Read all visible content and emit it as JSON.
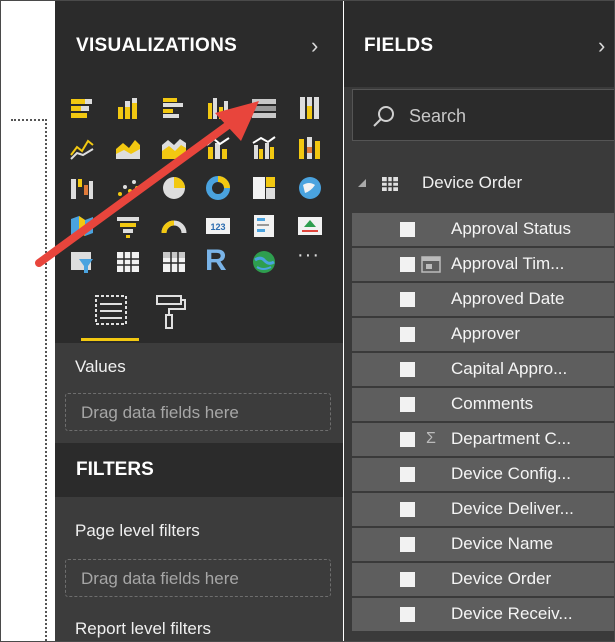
{
  "visualizations": {
    "title": "VISUALIZATIONS",
    "values_label": "Values",
    "values_drop": "Drag data fields here",
    "filters_title": "FILTERS",
    "page_level_filters": "Page level filters",
    "page_drop": "Drag data fields here",
    "report_level_filters": "Report level filters",
    "icons": [
      "stacked-bar-icon",
      "stacked-column-icon",
      "clustered-bar-icon",
      "clustered-column-icon",
      "100-stacked-bar-icon",
      "100-stacked-column-icon",
      "line-chart-icon",
      "area-chart-icon",
      "stacked-area-icon",
      "line-stacked-column-icon",
      "line-clustered-column-icon",
      "ribbon-chart-icon",
      "waterfall-icon",
      "scatter-icon",
      "pie-chart-icon",
      "donut-chart-icon",
      "treemap-icon",
      "map-icon",
      "filled-map-icon",
      "funnel-icon",
      "gauge-icon",
      "card-icon",
      "multi-row-card-icon",
      "kpi-icon",
      "slicer-icon",
      "table-icon",
      "matrix-icon",
      "r-visual-icon",
      "globe-icon",
      "more-icon"
    ],
    "r_label": "R",
    "card_label": "123",
    "more_label": "···"
  },
  "fields": {
    "title": "FIELDS",
    "search_placeholder": "Search",
    "table_name": "Device Order",
    "items": [
      {
        "label": "Approval Status",
        "type": ""
      },
      {
        "label": "Approval Tim...",
        "type": "date"
      },
      {
        "label": "Approved Date",
        "type": ""
      },
      {
        "label": "Approver",
        "type": ""
      },
      {
        "label": "Capital Appro...",
        "type": ""
      },
      {
        "label": "Comments",
        "type": ""
      },
      {
        "label": "Department C...",
        "type": "sigma"
      },
      {
        "label": "Device Config...",
        "type": ""
      },
      {
        "label": "Device Deliver...",
        "type": ""
      },
      {
        "label": "Device Name",
        "type": ""
      },
      {
        "label": "Device Order",
        "type": ""
      },
      {
        "label": "Device Receiv...",
        "type": ""
      }
    ]
  },
  "colors": {
    "accent": "#f2c811",
    "arrow": "#e8453c"
  }
}
